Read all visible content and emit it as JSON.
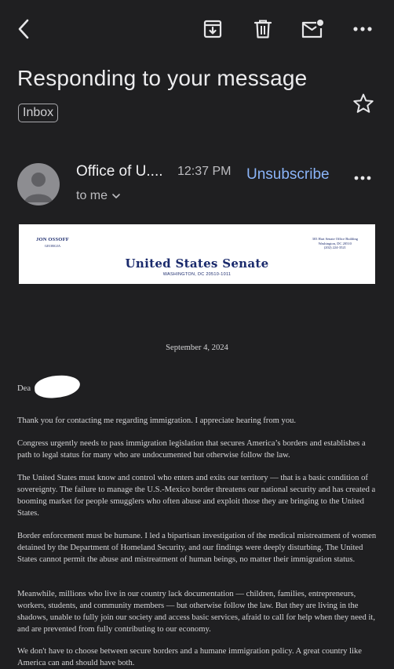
{
  "toolbar": {
    "back_icon": "chevron-left-icon",
    "archive_icon": "archive-icon",
    "delete_icon": "trash-icon",
    "mark_unread_icon": "mark-unread-icon",
    "more_icon": "more-horizontal-icon"
  },
  "email": {
    "subject": "Responding to your message",
    "label": "Inbox",
    "sender": "Office of U....",
    "time": "12:37 PM",
    "unsubscribe": "Unsubscribe",
    "recipient": "to me"
  },
  "letterhead": {
    "senator": "JON OSSOFF",
    "state": "GEORGIA",
    "title": "United States Senate",
    "city": "WASHINGTON, DC 20510-1011",
    "office_line1": "303 Hart Senate Office Building",
    "office_line2": "Washington, DC 20510",
    "office_line3": "(202) 224-3521"
  },
  "letter": {
    "date": "September 4, 2024",
    "salutation": "Dea",
    "paragraphs": [
      "Thank you for contacting me regarding immigration. I appreciate hearing from you.",
      "Congress urgently needs to pass immigration legislation that secures America’s borders and establishes a path to legal status for many who are undocumented but otherwise follow the law.",
      "The United States must know and control who enters and exits our territory — that is a basic condition of sovereignty. The failure to manage the U.S.-Mexico border threatens our national security and has created a booming market for people smugglers who often abuse and exploit those they are bringing to the United States.",
      "Border enforcement must be humane. I led a bipartisan investigation of the medical mistreatment of women detained by the Department of Homeland Security, and our findings were deeply disturbing. The United States cannot permit the abuse and mistreatment of human beings, no matter their immigration status.",
      "Meanwhile, millions who live in our country lack documentation — children, families, entrepreneurs, workers, students, and community members — but otherwise follow the law. But they are living in the shadows, unable to fully join our society and access basic services, afraid to call for help when they need it, and are prevented from fully contributing to our economy.",
      "We don't have to choose between secure borders and a humane immigration policy. A great country like America can and should have both."
    ]
  }
}
